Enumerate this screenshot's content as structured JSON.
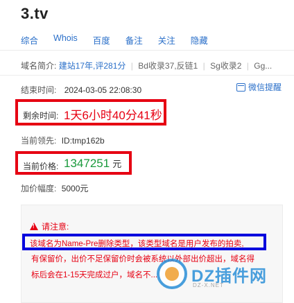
{
  "domain_title": "3.tv",
  "tabs": [
    "综合",
    "Whois",
    "百度",
    "备注",
    "关注",
    "隐藏"
  ],
  "intro": {
    "label": "域名简介:",
    "link": "建站17年,评281分",
    "items": [
      "Bd收录37,反链1",
      "Sg收录2",
      "Gg..."
    ]
  },
  "end_time": {
    "label": "结束时间:",
    "value": "2024-03-05 22:08:30"
  },
  "wechat": {
    "label": "微信提醒"
  },
  "remaining": {
    "label": "剩余时间:",
    "value": "1天6小时40分41秒"
  },
  "leader": {
    "label": "当前领先:",
    "value": "ID:tmp162b"
  },
  "price": {
    "label": "当前价格:",
    "value": "1347251",
    "unit": "元"
  },
  "increment": {
    "label": "加价幅度:",
    "value": "5000元"
  },
  "notice": {
    "title": "请注意:",
    "highlight": "该域名为Name-Pre删除类型，该类型域名是用户发布的拍卖,",
    "line2": "有保留价，出价不足保留价时会被系统以外部出价超出，域名得",
    "line3": "标后会在1-15天完成过户，域名不..."
  },
  "watermark": {
    "text": "DZ插件网",
    "sub": "DZ-X.NET"
  },
  "colors": {
    "link": "#2a6fc9",
    "red": "#e60012",
    "green": "#1a9a3c",
    "blue_box": "#0000dd"
  }
}
